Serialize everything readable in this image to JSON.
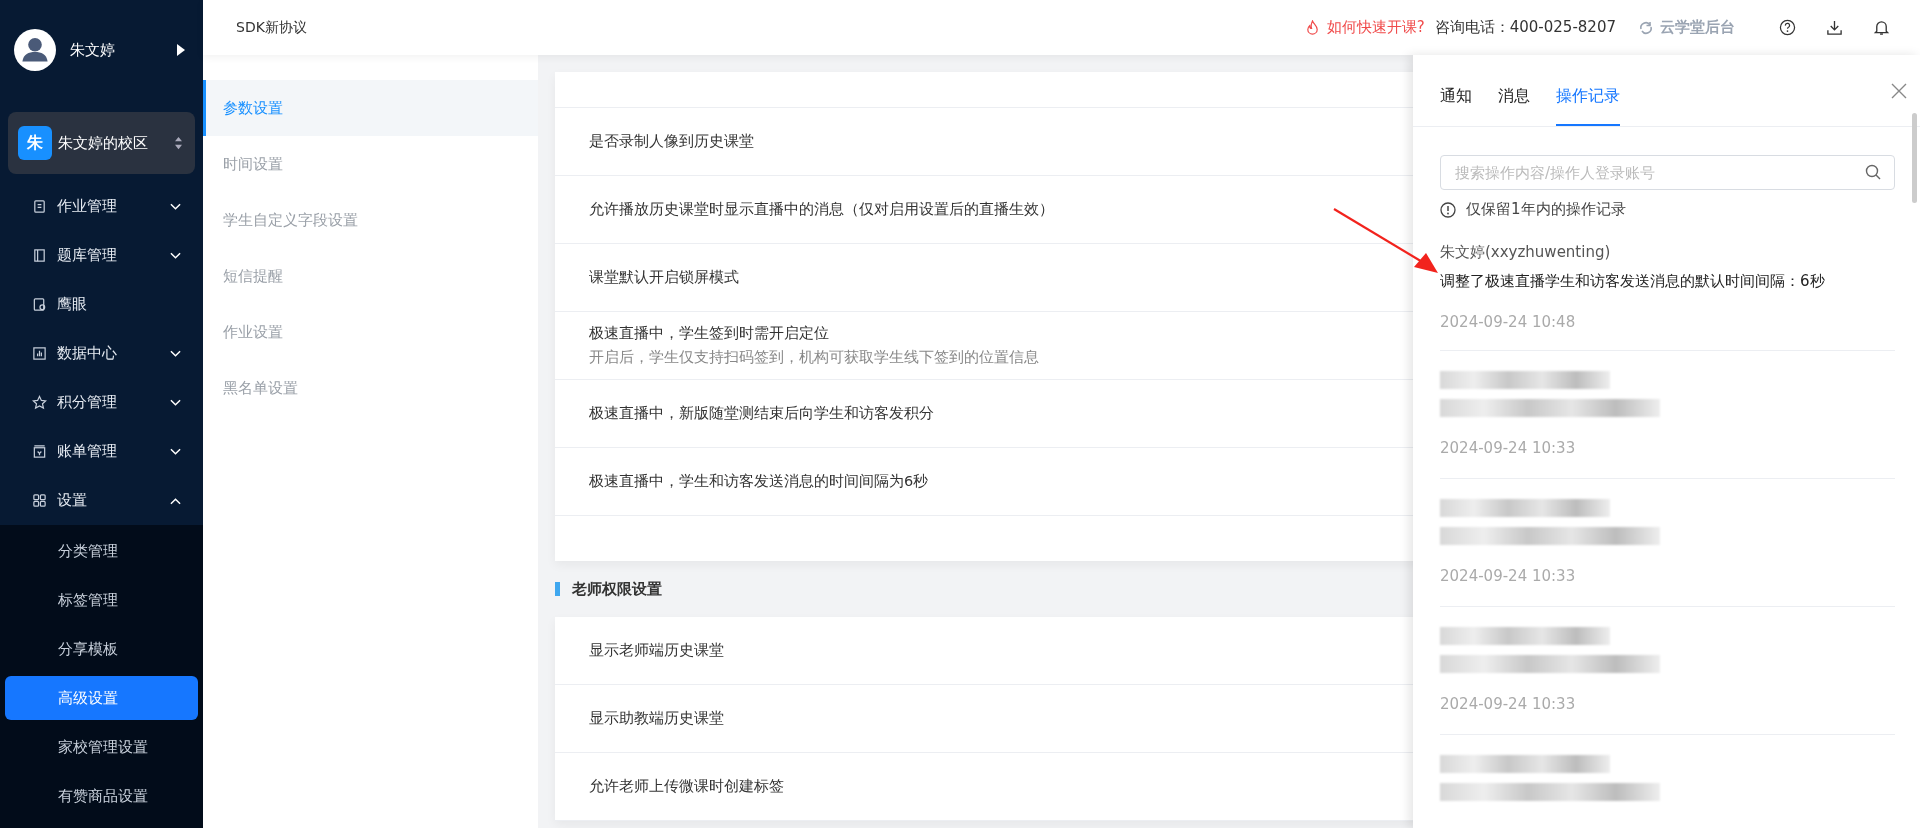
{
  "sidebar": {
    "user": {
      "name": "朱文婷"
    },
    "campus": {
      "initial": "朱",
      "name": "朱文婷的校区"
    },
    "menu": [
      {
        "kind": "homework",
        "label": "作业管理",
        "expanded": false
      },
      {
        "kind": "bank",
        "label": "题库管理",
        "expanded": false
      },
      {
        "kind": "eye",
        "label": "鹰眼"
      },
      {
        "kind": "chart",
        "label": "数据中心",
        "expanded": false
      },
      {
        "kind": "star",
        "label": "积分管理",
        "expanded": false
      },
      {
        "kind": "bill",
        "label": "账单管理",
        "expanded": false
      },
      {
        "kind": "grid",
        "label": "设置",
        "expanded": true,
        "children": [
          {
            "label": "分类管理",
            "selected": false
          },
          {
            "label": "标签管理",
            "selected": false
          },
          {
            "label": "分享模板",
            "selected": false
          },
          {
            "label": "高级设置",
            "selected": true
          },
          {
            "label": "家校管理设置",
            "selected": false
          },
          {
            "label": "有赞商品设置",
            "selected": false
          }
        ]
      }
    ]
  },
  "top_bar": {
    "title": "SDK新协议",
    "help_link": "如何快速开课?",
    "phone": "咨询电话：400-025-8207",
    "admin_link": "云学堂后台"
  },
  "sub_nav": [
    {
      "label": "参数设置",
      "selected": true
    },
    {
      "label": "时间设置",
      "selected": false
    },
    {
      "label": "学生自定义字段设置",
      "selected": false
    },
    {
      "label": "短信提醒",
      "selected": false
    },
    {
      "label": "作业设置",
      "selected": false
    },
    {
      "label": "黑名单设置",
      "selected": false
    }
  ],
  "settings": [
    {
      "label": "是否录制人像到历史课堂"
    },
    {
      "label": "允许播放历史课堂时显示直播中的消息（仅对启用设置后的直播生效）"
    },
    {
      "label": "课堂默认开启锁屏模式"
    },
    {
      "label": "极速直播中，学生签到时需开启定位",
      "hint": "开启后，学生仅支持扫码签到，机构可获取学生线下签到的位置信息"
    },
    {
      "label": "极速直播中，新版随堂测结束后向学生和访客发积分"
    },
    {
      "label": "极速直播中，学生和访客发送消息的时间间隔为6秒"
    }
  ],
  "teacher_section": {
    "title": "老师权限设置",
    "rows": [
      {
        "label": "显示老师端历史课堂"
      },
      {
        "label": "显示助教端历史课堂"
      },
      {
        "label": "允许老师上传微课时创建标签"
      }
    ]
  },
  "panel": {
    "tabs": [
      {
        "label": "通知",
        "selected": false
      },
      {
        "label": "消息",
        "selected": false
      },
      {
        "label": "操作记录",
        "selected": true
      }
    ],
    "search": {
      "placeholder": "搜索操作内容/操作人登录账号"
    },
    "note": "仅保留1年内的操作记录",
    "entries": [
      {
        "blurred": false,
        "user": "朱文婷(xxyzhuwenting)",
        "action": "调整了极速直播学生和访客发送消息的默认时间间隔：6秒",
        "time": "2024-09-24 10:48"
      },
      {
        "blurred": true,
        "time": "2024-09-24 10:33"
      },
      {
        "blurred": true,
        "time": "2024-09-24 10:33"
      },
      {
        "blurred": true,
        "time": "2024-09-24 10:33"
      },
      {
        "blurred": true
      }
    ]
  }
}
